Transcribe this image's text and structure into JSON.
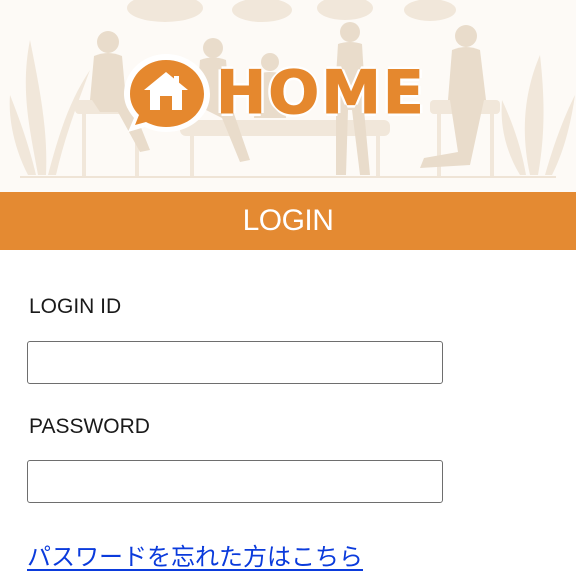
{
  "brand": {
    "logo_text": "HOME",
    "logo_icon": "house-speech-bubble-icon",
    "accent_color": "#e48a32"
  },
  "header": {
    "title": "LOGIN"
  },
  "form": {
    "login_id": {
      "label": "LOGIN ID",
      "value": ""
    },
    "password": {
      "label": "PASSWORD",
      "value": ""
    },
    "forgot_password_link": "パスワードを忘れた方はこちら"
  },
  "colors": {
    "header_bg": "#e48a32",
    "header_text": "#ffffff",
    "link": "#0b3bdc",
    "input_border": "#6e6e6e"
  }
}
